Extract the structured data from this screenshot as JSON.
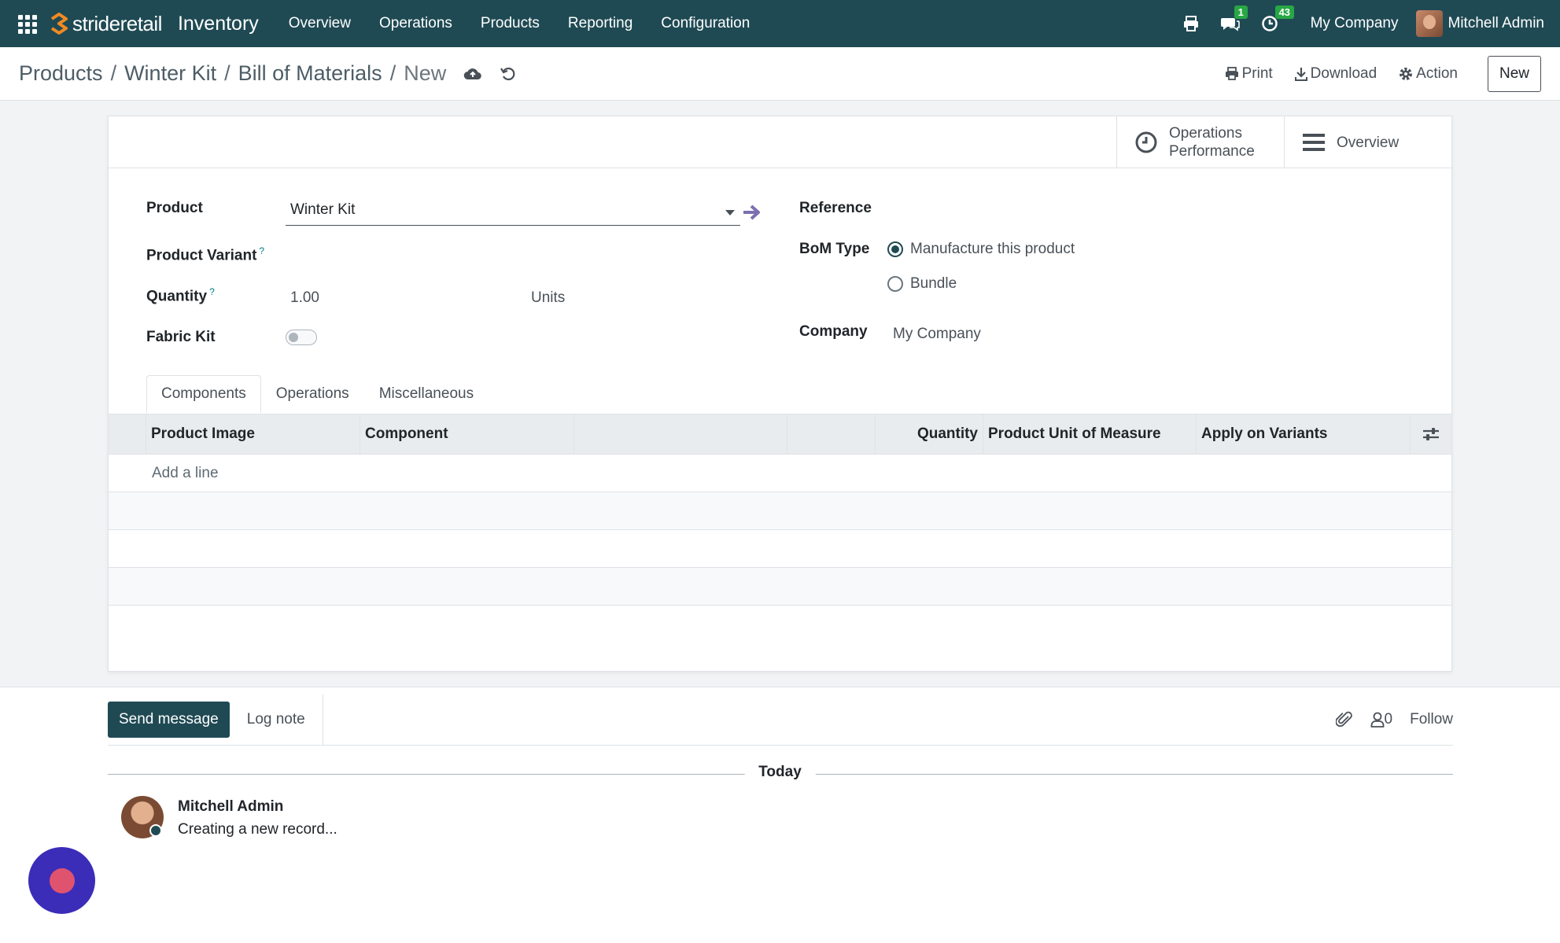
{
  "navbar": {
    "brand": "strideretail",
    "app_title": "Inventory",
    "menu": [
      "Overview",
      "Operations",
      "Products",
      "Reporting",
      "Configuration"
    ],
    "messages_badge": "1",
    "activities_badge": "43",
    "company": "My Company",
    "user": "Mitchell Admin"
  },
  "breadcrumb": {
    "items": [
      "Products",
      "Winter Kit",
      "Bill of Materials"
    ],
    "current": "New"
  },
  "actions": {
    "print": "Print",
    "download": "Download",
    "action": "Action",
    "new": "New"
  },
  "button_box": {
    "operations_performance_line1": "Operations",
    "operations_performance_line2": "Performance",
    "overview": "Overview"
  },
  "form": {
    "product_label": "Product",
    "product_value": "Winter Kit",
    "variant_label": "Product Variant",
    "quantity_label": "Quantity",
    "quantity_value": "1.00",
    "quantity_uom": "Units",
    "fabric_kit_label": "Fabric Kit",
    "fabric_kit_enabled": false,
    "reference_label": "Reference",
    "bom_type_label": "BoM Type",
    "bom_type_options": [
      "Manufacture this product",
      "Bundle"
    ],
    "bom_type_selected": "Manufacture this product",
    "company_label": "Company",
    "company_value": "My Company",
    "help_marker": "?"
  },
  "tabs": [
    "Components",
    "Operations",
    "Miscellaneous"
  ],
  "table": {
    "headers": [
      "Product Image",
      "Component",
      "",
      "",
      "Quantity",
      "Product Unit of Measure",
      "Apply on Variants"
    ],
    "add_line": "Add a line"
  },
  "chatter": {
    "send_message": "Send message",
    "log_note": "Log note",
    "followers_count": "0",
    "follow": "Follow",
    "date_separator": "Today",
    "message_author": "Mitchell Admin",
    "message_body": "Creating a new record..."
  },
  "colors": {
    "navbar": "#1f4a54",
    "primary_button": "#1f4a54",
    "link_arrow": "#7c6fb0",
    "help_marker": "#017e84",
    "floating_button": "#3b2db8"
  }
}
